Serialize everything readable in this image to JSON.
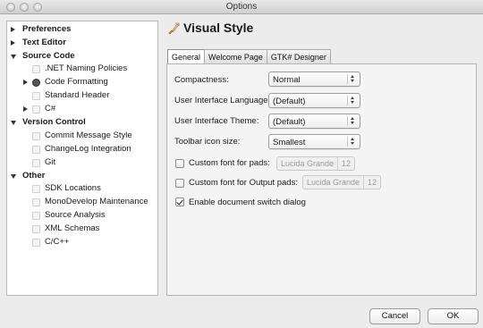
{
  "window": {
    "title": "Options"
  },
  "sidebar": {
    "items": [
      {
        "label": "Preferences",
        "level": 0,
        "expander": "collapsed"
      },
      {
        "label": "Text Editor",
        "level": 0,
        "expander": "collapsed"
      },
      {
        "label": "Source Code",
        "level": 0,
        "expander": "expanded"
      },
      {
        "label": ".NET Naming Policies",
        "level": 1,
        "expander": "none"
      },
      {
        "label": "Code Formatting",
        "level": 1,
        "expander": "collapsed"
      },
      {
        "label": "Standard Header",
        "level": 1,
        "expander": "none"
      },
      {
        "label": "C#",
        "level": 1,
        "expander": "collapsed"
      },
      {
        "label": "Version Control",
        "level": 0,
        "expander": "expanded"
      },
      {
        "label": "Commit Message Style",
        "level": 1,
        "expander": "none"
      },
      {
        "label": "ChangeLog Integration",
        "level": 1,
        "expander": "none"
      },
      {
        "label": "Git",
        "level": 1,
        "expander": "none"
      },
      {
        "label": "Other",
        "level": 0,
        "expander": "expanded"
      },
      {
        "label": "SDK Locations",
        "level": 1,
        "expander": "none"
      },
      {
        "label": "MonoDevelop Maintenance",
        "level": 1,
        "expander": "none"
      },
      {
        "label": "Source Analysis",
        "level": 1,
        "expander": "none"
      },
      {
        "label": "XML Schemas",
        "level": 1,
        "expander": "none"
      },
      {
        "label": "C/C++",
        "level": 1,
        "expander": "none"
      }
    ]
  },
  "page": {
    "title": "Visual Style",
    "icon": "paintbrush-icon",
    "tabs": [
      {
        "label": "General",
        "active": true
      },
      {
        "label": "Welcome Page",
        "active": false
      },
      {
        "label": "GTK# Designer",
        "active": false
      }
    ],
    "general": {
      "compactness": {
        "label": "Compactness:",
        "value": "Normal"
      },
      "ui_language": {
        "label": "User Interface Language:",
        "value": "(Default)"
      },
      "ui_theme": {
        "label": "User Interface Theme:",
        "value": "(Default)"
      },
      "toolbar_icon_size": {
        "label": "Toolbar icon size:",
        "value": "Smallest"
      },
      "custom_font_pads": {
        "label": "Custom font for pads:",
        "checked": false,
        "font_name": "Lucida Grande",
        "font_size": "12"
      },
      "custom_font_output_pads": {
        "label": "Custom font for Output pads:",
        "checked": false,
        "font_name": "Lucida Grande",
        "font_size": "12"
      },
      "doc_switch_dialog": {
        "label": "Enable document switch dialog",
        "checked": true
      }
    }
  },
  "buttons": {
    "cancel": "Cancel",
    "ok": "OK"
  }
}
